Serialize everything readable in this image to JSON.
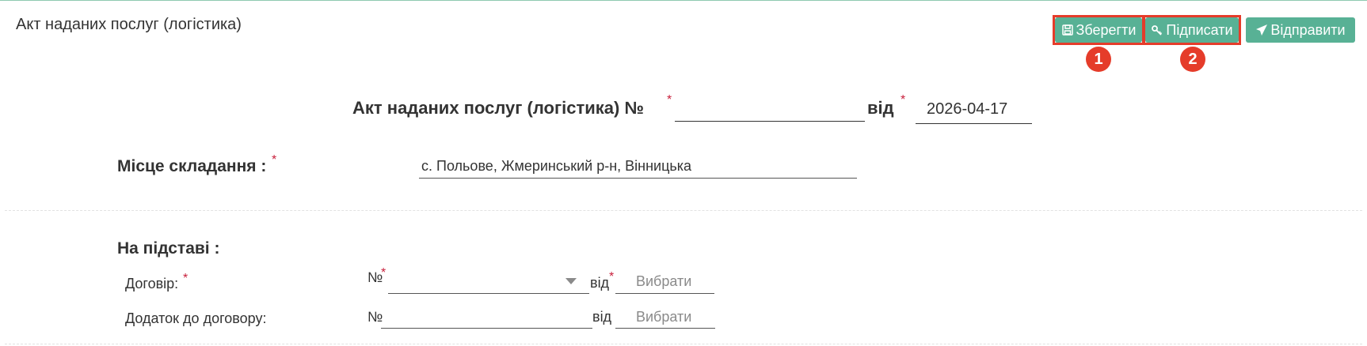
{
  "header": {
    "title": "Акт наданих послуг (логістика)"
  },
  "toolbar": {
    "save_label": "Зберегти",
    "sign_label": "Підписати",
    "send_label": "Відправити",
    "accent_color": "#58b195",
    "highlight_color": "#e53c2a"
  },
  "annotations": {
    "badge_1": "1",
    "badge_2": "2"
  },
  "document": {
    "heading": "Акт наданих послуг (логістика) №",
    "number_value": "",
    "date_prefix": "від",
    "date_value": "2026-04-17",
    "required_mark": "*"
  },
  "place": {
    "label": "Місце складання :",
    "value": "с. Польове, Жмеринський р-н, Вінницька"
  },
  "basis": {
    "section_label": "На підставі :",
    "contract": {
      "label": "Договір:",
      "number_prefix": "№",
      "number_value": "",
      "date_prefix": "від",
      "date_placeholder": "Вибрати"
    },
    "appendix": {
      "label": "Додаток до договору:",
      "number_prefix": "№",
      "number_value": "",
      "date_prefix": "від",
      "date_placeholder": "Вибрати"
    }
  }
}
